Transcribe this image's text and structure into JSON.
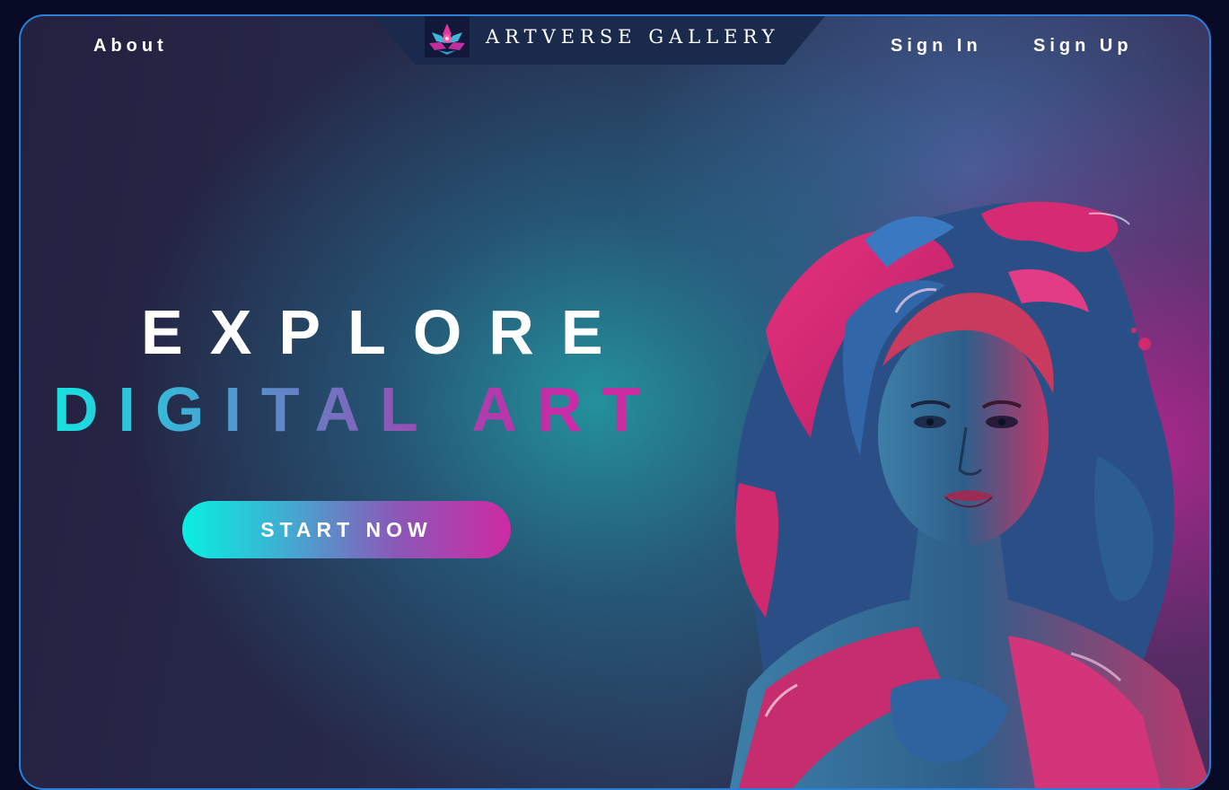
{
  "nav": {
    "about": "About",
    "brand": "ARTVERSE GALLERY",
    "sign_in": "Sign In",
    "sign_up": "Sign Up",
    "logo_icon": "lotus-flower-icon"
  },
  "hero": {
    "line1": "EXPLORE",
    "line2": "DIGITAL ART",
    "cta": "START NOW",
    "image": "paint-splash-portrait"
  },
  "colors": {
    "frame_border": "#2a7fd6",
    "accent_cyan": "#18e2e0",
    "accent_magenta": "#d32a9f",
    "background": "#060a24"
  }
}
